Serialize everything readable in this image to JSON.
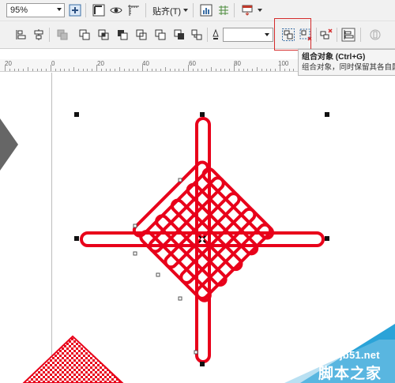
{
  "toolbar": {
    "zoom_value": "95%",
    "snap_label": "贴齐(T)",
    "snap_icon": "snap-icon",
    "zoom_fit_icon": "zoom-to-fit-icon",
    "view_icons": [
      "frame-icon",
      "eye-icon",
      "rulers-icon"
    ],
    "chart_icon": "chart-icon",
    "grid_icon": "grid-icon",
    "import_icon": "import-icon"
  },
  "property_bar": {
    "outline_value": "",
    "tools": [
      "align-left-icon",
      "align-distribute-icon",
      "weld-icon",
      "trim-icon",
      "intersect-icon",
      "simplify-icon",
      "front-minus-back-icon",
      "back-minus-front-icon",
      "boundary-icon",
      "pen-outline-icon"
    ],
    "group_button": "group-objects-icon",
    "ungroup_button": "ungroup-objects-icon",
    "ungroup_all_button": "ungroup-all-icon",
    "align_panel_button": "align-panel-icon",
    "wrap_text_button": "wrap-text-icon"
  },
  "tooltip": {
    "title": "组合对象 (Ctrl+G)",
    "description": "组合对象，同时保留其各自属性"
  },
  "ruler": {
    "labels": [
      "20",
      "0",
      "20",
      "40",
      "60",
      "80",
      "100"
    ]
  },
  "watermark": {
    "site": "jb51.net",
    "name": "脚本之家"
  },
  "colors": {
    "knot_red": "#e8001a",
    "highlight_red": "#d42b2b",
    "watermark_blue": "#2aa3d8"
  }
}
